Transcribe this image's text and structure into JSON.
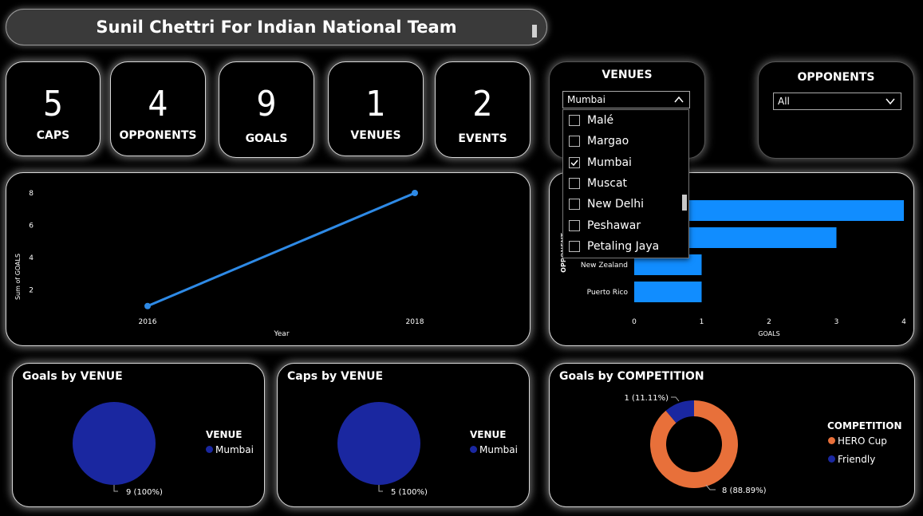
{
  "title": "Sunil Chettri For Indian National Team",
  "kpis": [
    {
      "value": "5",
      "label": "CAPS"
    },
    {
      "value": "4",
      "label": "OPPONENTS"
    },
    {
      "value": "9",
      "label": "GOALS"
    },
    {
      "value": "1",
      "label": "VENUES"
    },
    {
      "value": "2",
      "label": "EVENTS"
    }
  ],
  "venues_slicer": {
    "title": "VENUES",
    "selected": "Mumbai",
    "options": [
      {
        "label": "Malé",
        "checked": false
      },
      {
        "label": "Margao",
        "checked": false
      },
      {
        "label": "Mumbai",
        "checked": true
      },
      {
        "label": "Muscat",
        "checked": false
      },
      {
        "label": "New Delhi",
        "checked": false
      },
      {
        "label": "Peshawar",
        "checked": false
      },
      {
        "label": "Petaling Jaya",
        "checked": false
      }
    ]
  },
  "opponents_slicer": {
    "title": "OPPONENTS",
    "selected": "All"
  },
  "colors": {
    "accent": "#118DFF",
    "line": "#2E8AE6",
    "pie": "#1A27A0",
    "hero": "#E8703A",
    "friendly": "#1A27A0"
  },
  "chart_data": [
    {
      "type": "line",
      "x": [
        2016,
        2018
      ],
      "y": [
        1,
        8
      ],
      "xlabel": "Year",
      "ylabel": "Sum of GOALS",
      "yticks": [
        2,
        4,
        6,
        8
      ],
      "ylim": [
        0,
        8
      ]
    },
    {
      "type": "bar",
      "orientation": "horizontal",
      "categories": [
        "",
        "",
        "New Zealand",
        "Puerto Rico"
      ],
      "values": [
        4,
        3,
        1,
        1
      ],
      "xlabel": "GOALS",
      "ylabel": "OPPONENT",
      "xticks": [
        0,
        1,
        2,
        3,
        4
      ],
      "xlim": [
        0,
        4
      ]
    },
    {
      "type": "pie",
      "title": "Goals by VENUE",
      "legend_title": "VENUE",
      "categories": [
        "Mumbai"
      ],
      "values": [
        9
      ],
      "data_label": "9 (100%)"
    },
    {
      "type": "pie",
      "title": "Caps by VENUE",
      "legend_title": "VENUE",
      "categories": [
        "Mumbai"
      ],
      "values": [
        5
      ],
      "data_label": "5 (100%)"
    },
    {
      "type": "pie",
      "title": "Goals by COMPETITION",
      "legend_title": "COMPETITION",
      "categories": [
        "HERO Cup",
        "Friendly"
      ],
      "values": [
        8,
        1
      ],
      "data_labels": [
        "8 (88.89%)",
        "1 (11.11%)"
      ]
    }
  ]
}
